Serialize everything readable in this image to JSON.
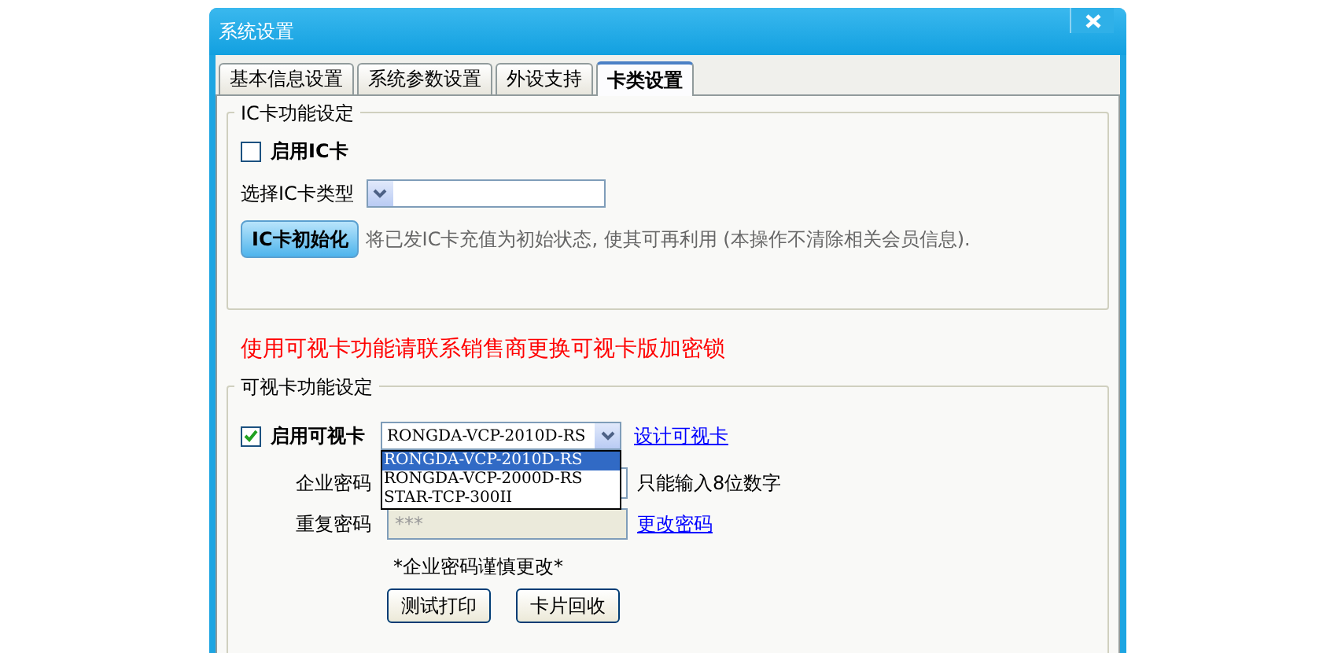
{
  "window": {
    "title": "系统设置"
  },
  "tabs": [
    {
      "label": "基本信息设置",
      "selected": false
    },
    {
      "label": "系统参数设置",
      "selected": false
    },
    {
      "label": "外设支持",
      "selected": false
    },
    {
      "label": "卡类设置",
      "selected": true
    }
  ],
  "ic_section": {
    "legend": "IC卡功能设定",
    "enable": {
      "label": "启用IC卡",
      "checked": false
    },
    "card_type": {
      "label": "选择IC卡类型"
    },
    "init_button": "IC卡初始化",
    "init_description": "将已发IC卡充值为初始状态, 使其可再利用 (本操作不清除相关会员信息)."
  },
  "warning": "使用可视卡功能请联系销售商更换可视卡版加密锁",
  "visual_section": {
    "legend": "可视卡功能设定",
    "enable": {
      "label": "启用可视卡",
      "checked": true
    },
    "printer_select": {
      "value": "RONGDA-VCP-2010D-RS",
      "expanded": true,
      "options": [
        {
          "label": "RONGDA-VCP-2010D-RS",
          "selected": true
        },
        {
          "label": "RONGDA-VCP-2000D-RS",
          "selected": false
        },
        {
          "label": "STAR-TCP-300II",
          "selected": false
        }
      ]
    },
    "design_link": "设计可视卡",
    "company_password": {
      "label": "企业密码",
      "hint": "只能输入8位数字"
    },
    "repeat_password": {
      "label": "重复密码",
      "value": "***",
      "disabled": true
    },
    "change_link": "更改密码",
    "note": "*企业密码谨慎更改*",
    "buttons": [
      "测试打印",
      "卡片回收"
    ]
  }
}
